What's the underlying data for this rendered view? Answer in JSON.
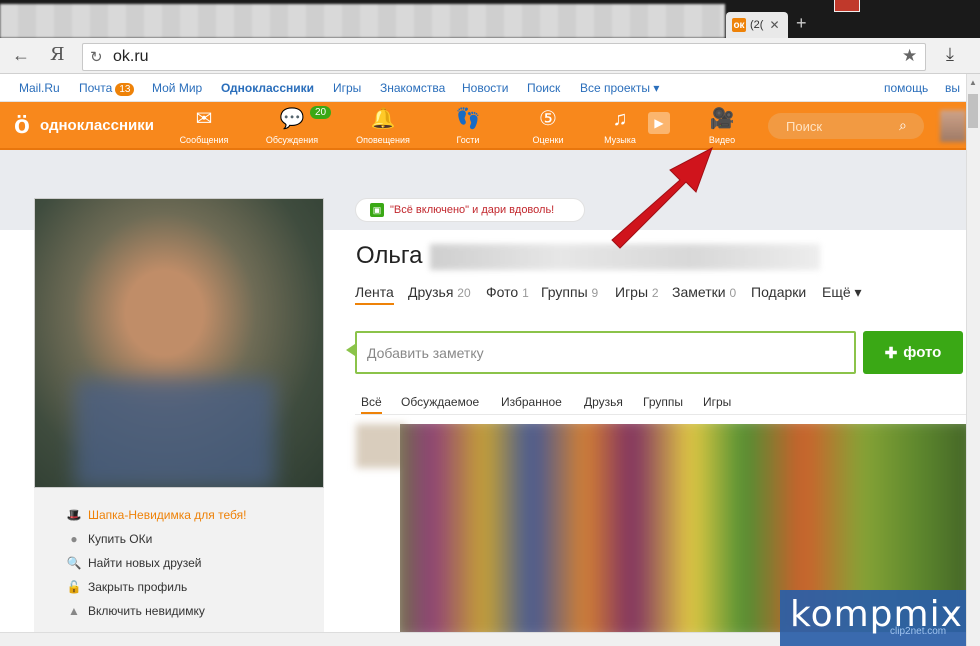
{
  "browser": {
    "tab_title": "(2(",
    "tab_close": "✕",
    "url": "ok.ru",
    "yandex_label": "Я"
  },
  "portal_bar": {
    "links": [
      "Mail.Ru",
      "Почта",
      "Мой Мир",
      "Одноклассники",
      "Игры",
      "Знакомства",
      "Новости",
      "Поиск",
      "Все проекты ▾"
    ],
    "mail_badge": "13",
    "help": "помощь",
    "exit": "вы"
  },
  "header": {
    "logo_text": "одноклассники",
    "nav": [
      {
        "label": "Сообщения",
        "icon": "envelope-icon"
      },
      {
        "label": "Обсуждения",
        "icon": "discussion-icon"
      },
      {
        "label": "Оповещения",
        "icon": "bell-icon"
      },
      {
        "label": "Гости",
        "icon": "footprints-icon"
      },
      {
        "label": "Оценки",
        "icon": "rating-icon"
      },
      {
        "label": "Музыка",
        "icon": "music-icon"
      },
      {
        "label": "Видео",
        "icon": "video-icon"
      }
    ],
    "discussions_badge": "20",
    "search_placeholder": "Поиск"
  },
  "profile": {
    "promo": "\"Всё включено\" и дари вдоволь!",
    "name": "Ольга",
    "tabs": [
      {
        "label": "Лента",
        "count": ""
      },
      {
        "label": "Друзья",
        "count": "20"
      },
      {
        "label": "Фото",
        "count": "1"
      },
      {
        "label": "Группы",
        "count": "9"
      },
      {
        "label": "Игры",
        "count": "2"
      },
      {
        "label": "Заметки",
        "count": "0"
      },
      {
        "label": "Подарки",
        "count": ""
      },
      {
        "label": "Ещё ▾",
        "count": ""
      }
    ],
    "note_placeholder": "Добавить заметку",
    "photo_button": "фото",
    "feed_filters": [
      "Всё",
      "Обсуждаемое",
      "Избранное",
      "Друзья",
      "Группы",
      "Игры"
    ],
    "left_menu": [
      "Шапка-Невидимка для тебя!",
      "Купить ОКи",
      "Найти новых друзей",
      "Закрыть профиль",
      "Включить невидимку"
    ]
  },
  "watermark": {
    "text": "kompmix",
    "sub": "clip2net.com"
  },
  "colors": {
    "ok_orange": "#f8881c",
    "green": "#3aa815",
    "arrow_red": "#d0141c"
  }
}
